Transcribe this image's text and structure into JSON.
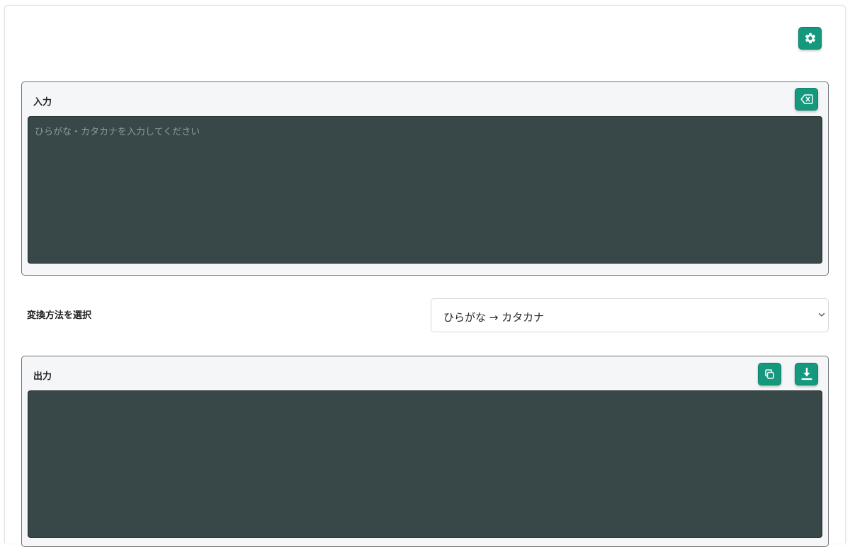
{
  "header": {
    "settings_icon": "gear-icon"
  },
  "input": {
    "label": "入力",
    "placeholder": "ひらがな・カタカナを入力してください",
    "value": "",
    "clear_icon": "backspace-icon"
  },
  "conversion": {
    "label": "変換方法を選択",
    "selected": "ひらがな → カタカナ",
    "chevron_icon": "chevron-down-icon"
  },
  "output": {
    "label": "出力",
    "value": "",
    "copy_icon": "copy-icon",
    "download_icon": "download-icon"
  },
  "colors": {
    "accent": "#14997e",
    "textarea_bg": "#384748",
    "panel_bg": "#f5f6f8"
  }
}
